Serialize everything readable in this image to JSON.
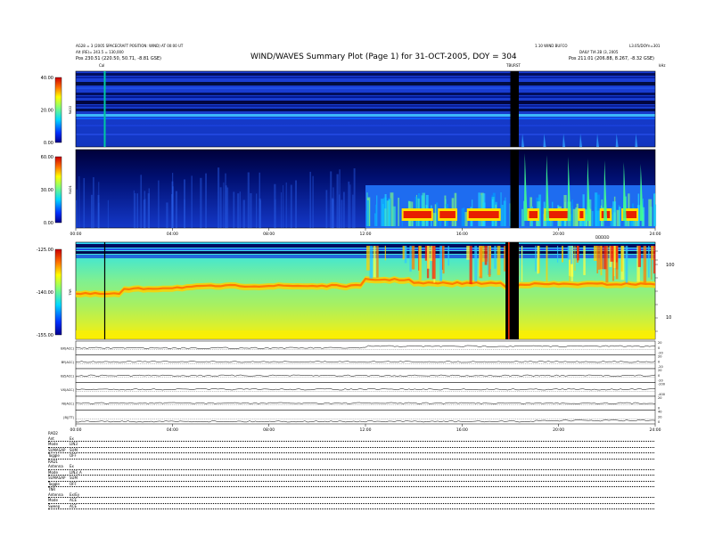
{
  "header": {
    "title": "WIND/WAVES Summary Plot (Page 1) for 31-OCT-2005, DOY = 304",
    "left_line1": "AG28 = 3 (2005 SPACECRAFT POSITION: WIND) AT 00:00 UT",
    "left_line2": "Alt (RE)= 243.5 = 130,000",
    "left_pos": "Pos  230.51 (220.50, 50.71, -8.81 GSE)",
    "right_line1": "1.10 WIND BUFCO",
    "right_line1b": "L3.05/DOYn=301",
    "right_line2": "DAILY TIA 2B (3, 2005",
    "right_pos": "Pos  211.01 (206.88, 8.267, -8.32 GSE)",
    "marker_left": "Cal",
    "marker_mid": "TBURST",
    "marker_right": "kHz",
    "marker_dust": "DDDDD"
  },
  "colors": {
    "black": "#000000",
    "background_blue": "#1030c8",
    "data_gap": "#000000"
  },
  "chart_data": [
    {
      "type": "heatmap",
      "name": "RAD2",
      "ylabel": "RAD2",
      "colorbar_ticks": [
        "40.00",
        "20.00",
        "0.00"
      ],
      "colorbar_range": [
        0,
        40
      ],
      "xlim_hours": [
        0,
        24
      ],
      "data_gap_hours": [
        18.0,
        18.35
      ],
      "bursts_hours": [
        18.5,
        19.4,
        20.2,
        20.9,
        21.6,
        22.4,
        23.2
      ]
    },
    {
      "type": "heatmap",
      "name": "RAD1",
      "ylabel": "RAD1",
      "colorbar_ticks": [
        "60.00",
        "30.00",
        "0.00"
      ],
      "colorbar_range": [
        0,
        60
      ],
      "xlim_hours": [
        0,
        24
      ],
      "x_ticks": [
        "00:00",
        "04:00",
        "08:00",
        "12:00",
        "16:00",
        "20:00",
        "24:00"
      ],
      "data_gap_hours": [
        18.0,
        18.35
      ],
      "activity_start_hours": 12.0
    },
    {
      "type": "heatmap",
      "name": "TNR",
      "ylabel": "TNR",
      "colorbar_ticks": [
        "-125.00",
        "-140.00",
        "-155.00"
      ],
      "colorbar_range": [
        -155,
        -125
      ],
      "right_axis_ticks": [
        "100",
        "10"
      ],
      "right_axis_unit": "kHz",
      "xlim_hours": [
        0,
        24
      ],
      "data_gap_hours": [
        17.8,
        18.35
      ],
      "cal_marker_hours": 1.2,
      "plasma_line_khz": [
        24,
        25,
        28,
        22,
        30,
        33,
        26,
        28
      ]
    },
    {
      "type": "line",
      "name": "stack",
      "x_ticks": [
        "00:00",
        "04:00",
        "08:00",
        "12:00",
        "16:00",
        "20:00",
        "24:00"
      ],
      "xlim_hours": [
        0,
        24
      ],
      "panels": [
        {
          "label": "BX(ACC)",
          "right_ticks": [
            "20",
            "0",
            "-20"
          ]
        },
        {
          "label": "BY(ACC)",
          "right_ticks": [
            "20",
            "0",
            "-20"
          ]
        },
        {
          "label": "BZ(ACC)",
          "right_ticks": [
            "20",
            "0",
            "-20"
          ]
        },
        {
          "label": "VX(ACC)",
          "right_ticks": [
            "-200",
            "-400"
          ]
        },
        {
          "label": "NI(ACC)",
          "right_ticks": [
            "20",
            "0"
          ]
        },
        {
          "label": "|B|(TT)",
          "right_ticks": [
            "40",
            "20",
            "0"
          ]
        }
      ]
    }
  ],
  "settings": {
    "rad2_header": "RAD2",
    "rad2_rows": [
      {
        "key": "Ant",
        "val": "Ex"
      },
      {
        "key": "Mode",
        "val": "LIN3"
      },
      {
        "key": "SUMASAP",
        "val": "SUM"
      },
      {
        "key": "Toggle",
        "val": "OFF"
      }
    ],
    "rad1_header": "RAD1",
    "rad1_rows": [
      {
        "key": "Antenna",
        "val": "Ex"
      },
      {
        "key": "Mode",
        "val": "LIN3_A"
      },
      {
        "key": "SUMASAP",
        "val": "SUM"
      },
      {
        "key": "Toggle",
        "val": "OFF"
      }
    ],
    "tnr_header": "TNR",
    "tnr_rows": [
      {
        "key": "Antenna",
        "val": "Ex/Ey"
      },
      {
        "key": "Mode",
        "val": "ACE"
      },
      {
        "key": "Sweep",
        "val": "ACE"
      }
    ]
  }
}
